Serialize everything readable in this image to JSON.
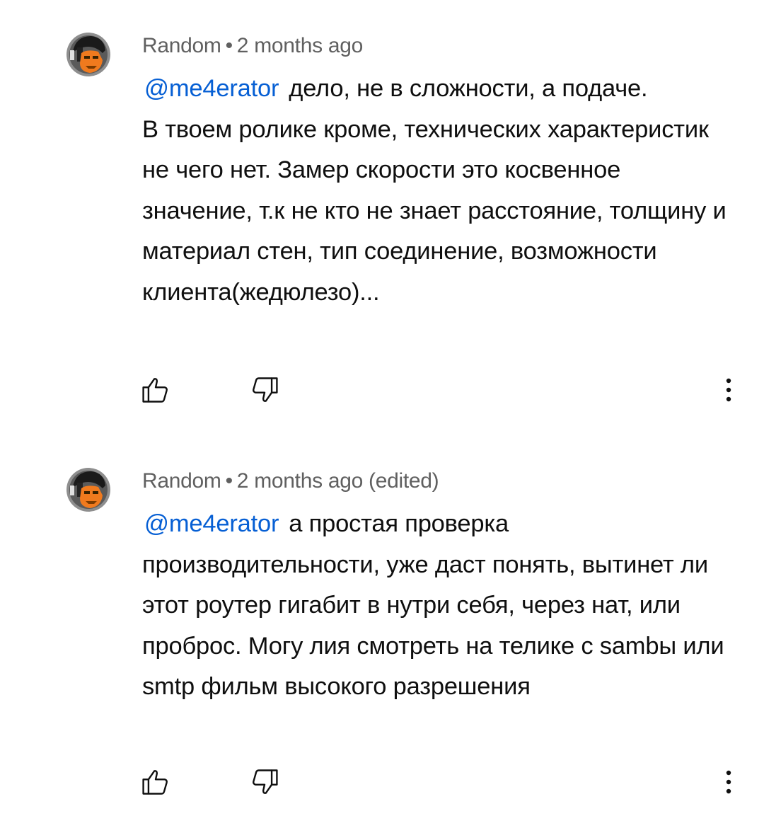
{
  "comments": [
    {
      "author": "Random",
      "separator": "•",
      "time": "2 months ago",
      "edited": "",
      "mention": "@me4erator",
      "text": "дело, не в сложности, а подаче.\nВ твоем ролике кроме, технических характеристик не чего нет. Замер скорости это косвенное значение, т.к не кто не знает расстояние, толщину и материал стен, тип соединение, возможности клиента(жедюлезо)...",
      "avatar_icon": "avatar-icon",
      "like_icon": "thumb-up-icon",
      "dislike_icon": "thumb-down-icon",
      "more_icon": "more-vert-icon"
    },
    {
      "author": "Random",
      "separator": "•",
      "time": "2 months ago",
      "edited": "(edited)",
      "mention": "@me4erator",
      "text": "а простая проверка производительности, уже даст понять, вытинет ли этот роутер гигабит в нутри себя, через нат, или проброс. Могу лия смотреть на телике с sambы  или smtp фильм высокого разрешения",
      "avatar_icon": "avatar-icon",
      "like_icon": "thumb-up-icon",
      "dislike_icon": "thumb-down-icon",
      "more_icon": "more-vert-icon"
    }
  ],
  "colors": {
    "text": "#0f0f0f",
    "meta": "#606060",
    "mention": "#065fd4",
    "avatar_orange": "#f07a1e"
  }
}
